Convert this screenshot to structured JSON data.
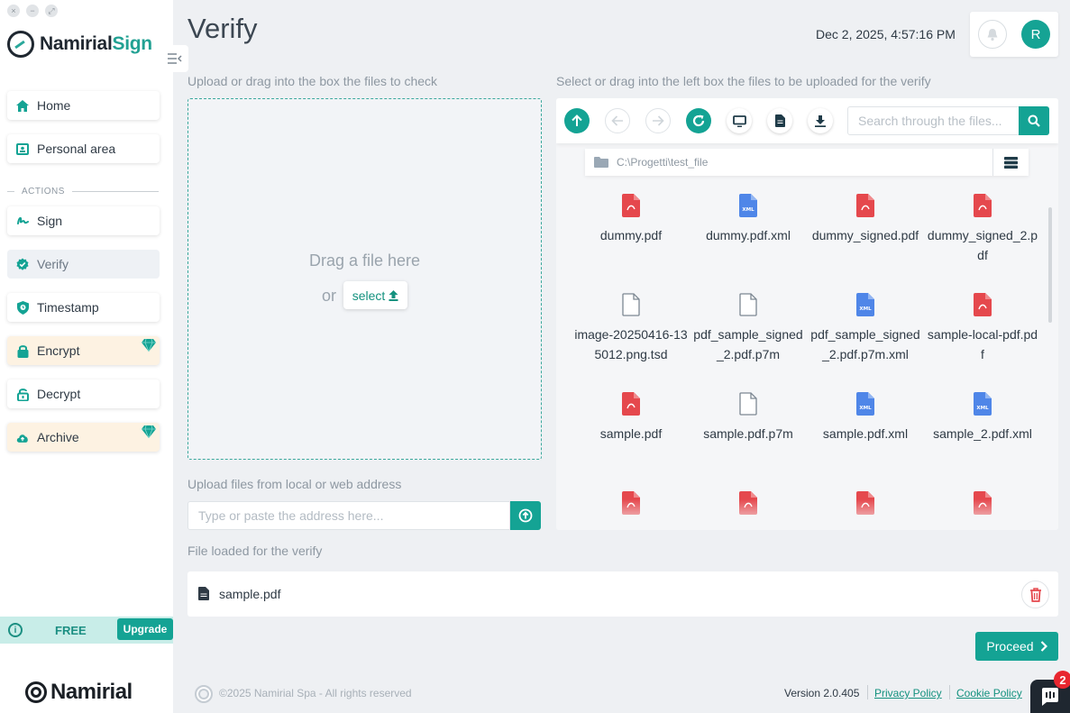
{
  "window": {
    "controls": [
      "×",
      "−",
      "⤢"
    ]
  },
  "brand": {
    "name_part1": "Namirial",
    "name_part2": "Sign"
  },
  "sidebar": {
    "items": [
      {
        "label": "Home",
        "icon": "home-icon"
      },
      {
        "label": "Personal area",
        "icon": "id-card-icon"
      },
      {
        "label": "Sign",
        "icon": "signature-icon"
      },
      {
        "label": "Verify",
        "icon": "check-badge-icon",
        "active": true
      },
      {
        "label": "Timestamp",
        "icon": "shield-clock-icon"
      },
      {
        "label": "Encrypt",
        "icon": "lock-icon",
        "premium": true
      },
      {
        "label": "Decrypt",
        "icon": "unlock-icon"
      },
      {
        "label": "Archive",
        "icon": "cloud-upload-icon",
        "premium": true
      }
    ],
    "section_label": "ACTIONS",
    "plan": {
      "label": "FREE",
      "upgrade_label": "Upgrade"
    },
    "footer_brand": "Namirial"
  },
  "header": {
    "title": "Verify",
    "datetime": "Dec 2, 2025, 4:57:16 PM",
    "avatar_initial": "R"
  },
  "upload": {
    "label": "Upload or drag into the box the files to check",
    "drop_text": "Drag a file here",
    "or_text": "or",
    "select_label": "select"
  },
  "url_upload": {
    "label": "Upload files from local or web address",
    "placeholder": "Type or paste the address here..."
  },
  "browser": {
    "label": "Select or drag into the left box the files to be uploaded for the verify",
    "search_placeholder": "Search through the files...",
    "path": "C:\\Progetti\\test_file",
    "files": [
      {
        "name": "dummy.pdf",
        "type": "pdf"
      },
      {
        "name": "dummy.pdf.xml",
        "type": "xml"
      },
      {
        "name": "dummy_signed.pdf",
        "type": "pdf"
      },
      {
        "name": "dummy_signed_2.pdf",
        "type": "pdf"
      },
      {
        "name": "image-20250416-135012.png.tsd",
        "type": "generic"
      },
      {
        "name": "pdf_sample_signed_2.pdf.p7m",
        "type": "generic"
      },
      {
        "name": "pdf_sample_signed_2.pdf.p7m.xml",
        "type": "xml"
      },
      {
        "name": "sample-local-pdf.pdf",
        "type": "pdf"
      },
      {
        "name": "sample.pdf",
        "type": "pdf"
      },
      {
        "name": "sample.pdf.p7m",
        "type": "generic"
      },
      {
        "name": "sample.pdf.xml",
        "type": "xml"
      },
      {
        "name": "sample_2.pdf.xml",
        "type": "xml"
      },
      {
        "name": "",
        "type": "pdf"
      },
      {
        "name": "",
        "type": "pdf"
      },
      {
        "name": "",
        "type": "pdf"
      },
      {
        "name": "",
        "type": "pdf"
      }
    ]
  },
  "loaded": {
    "label": "File loaded for the verify",
    "file_name": "sample.pdf"
  },
  "actions": {
    "proceed_label": "Proceed"
  },
  "footer": {
    "copyright": "©2025 Namirial Spa - All rights reserved",
    "version": "Version 2.0.405",
    "privacy_label": "Privacy Policy",
    "cookie_label": "Cookie Policy",
    "chat_badge": "2"
  },
  "colors": {
    "accent": "#14a394",
    "pdf": "#e5484d",
    "xml": "#4f86e8",
    "premium_bg": "#fdf2e2",
    "danger": "#e5484d"
  }
}
